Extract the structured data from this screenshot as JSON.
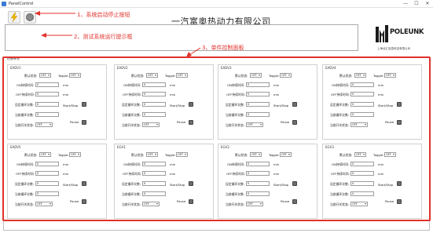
{
  "window": {
    "title": "PanelControl",
    "minimize_glyph": "—",
    "maximize_glyph": "☐",
    "close_glyph": "✕"
  },
  "toolbar": {
    "start_icon": "lightning-icon",
    "stop_icon": "stop-icon",
    "company_name": "一汽富奥热动力有限公司"
  },
  "logo": {
    "brand": "POLEUNK",
    "subtitle": "上海北汇信息科技有限公司"
  },
  "annotations": {
    "a1": "1、系统启动停止按钮",
    "a2": "2、测试系统运行提示框",
    "a3": "3、单件控制面板",
    "color": "#e0322b"
  },
  "group": {
    "legend": "控制单元"
  },
  "labels": {
    "default_state": "默认状态:",
    "toggle": "Toggle:",
    "on_time": "ON持续时间:",
    "off_time": "OFF持续时间:",
    "set_cycles": "设定循环次数:",
    "cur_cycles": "当前循环次数:",
    "cur_switch": "当前开关状态:",
    "min": "min",
    "start_stop": "Start/Stop",
    "pause": "Pause"
  },
  "units": [
    {
      "name": "EADV1",
      "default_state": "OFF",
      "toggle": "OFF",
      "on_time": "0",
      "off_time": "0",
      "set_cycles": "0",
      "cur_cycles": "0",
      "cur_switch": "OFF"
    },
    {
      "name": "EADV2",
      "default_state": "OFF",
      "toggle": "OFF",
      "on_time": "0",
      "off_time": "0",
      "set_cycles": "0",
      "cur_cycles": "0",
      "cur_switch": "OFF"
    },
    {
      "name": "EADV3",
      "default_state": "OFF",
      "toggle": "OFF",
      "on_time": "0",
      "off_time": "0",
      "set_cycles": "0",
      "cur_cycles": "0",
      "cur_switch": "OFF"
    },
    {
      "name": "EADV4",
      "default_state": "OFF",
      "toggle": "OFF",
      "on_time": "0",
      "off_time": "0",
      "set_cycles": "0",
      "cur_cycles": "0",
      "cur_switch": "OFF"
    },
    {
      "name": "EADV5",
      "default_state": "OFF",
      "toggle": "OFF",
      "on_time": "0",
      "off_time": "0",
      "set_cycles": "0",
      "cur_cycles": "0",
      "cur_switch": "OFF"
    },
    {
      "name": "EGV1",
      "default_state": "OFF",
      "toggle": "OFF",
      "on_time": "0",
      "off_time": "0",
      "set_cycles": "0",
      "cur_cycles": "0",
      "cur_switch": "OFF"
    },
    {
      "name": "EGV2",
      "default_state": "OFF",
      "toggle": "OFF",
      "on_time": "0",
      "off_time": "0",
      "set_cycles": "0",
      "cur_cycles": "0",
      "cur_switch": "OFF"
    },
    {
      "name": "EGV3",
      "default_state": "OFF",
      "toggle": "OFF",
      "on_time": "0",
      "off_time": "0",
      "set_cycles": "0",
      "cur_cycles": "0",
      "cur_switch": "OFF"
    }
  ]
}
